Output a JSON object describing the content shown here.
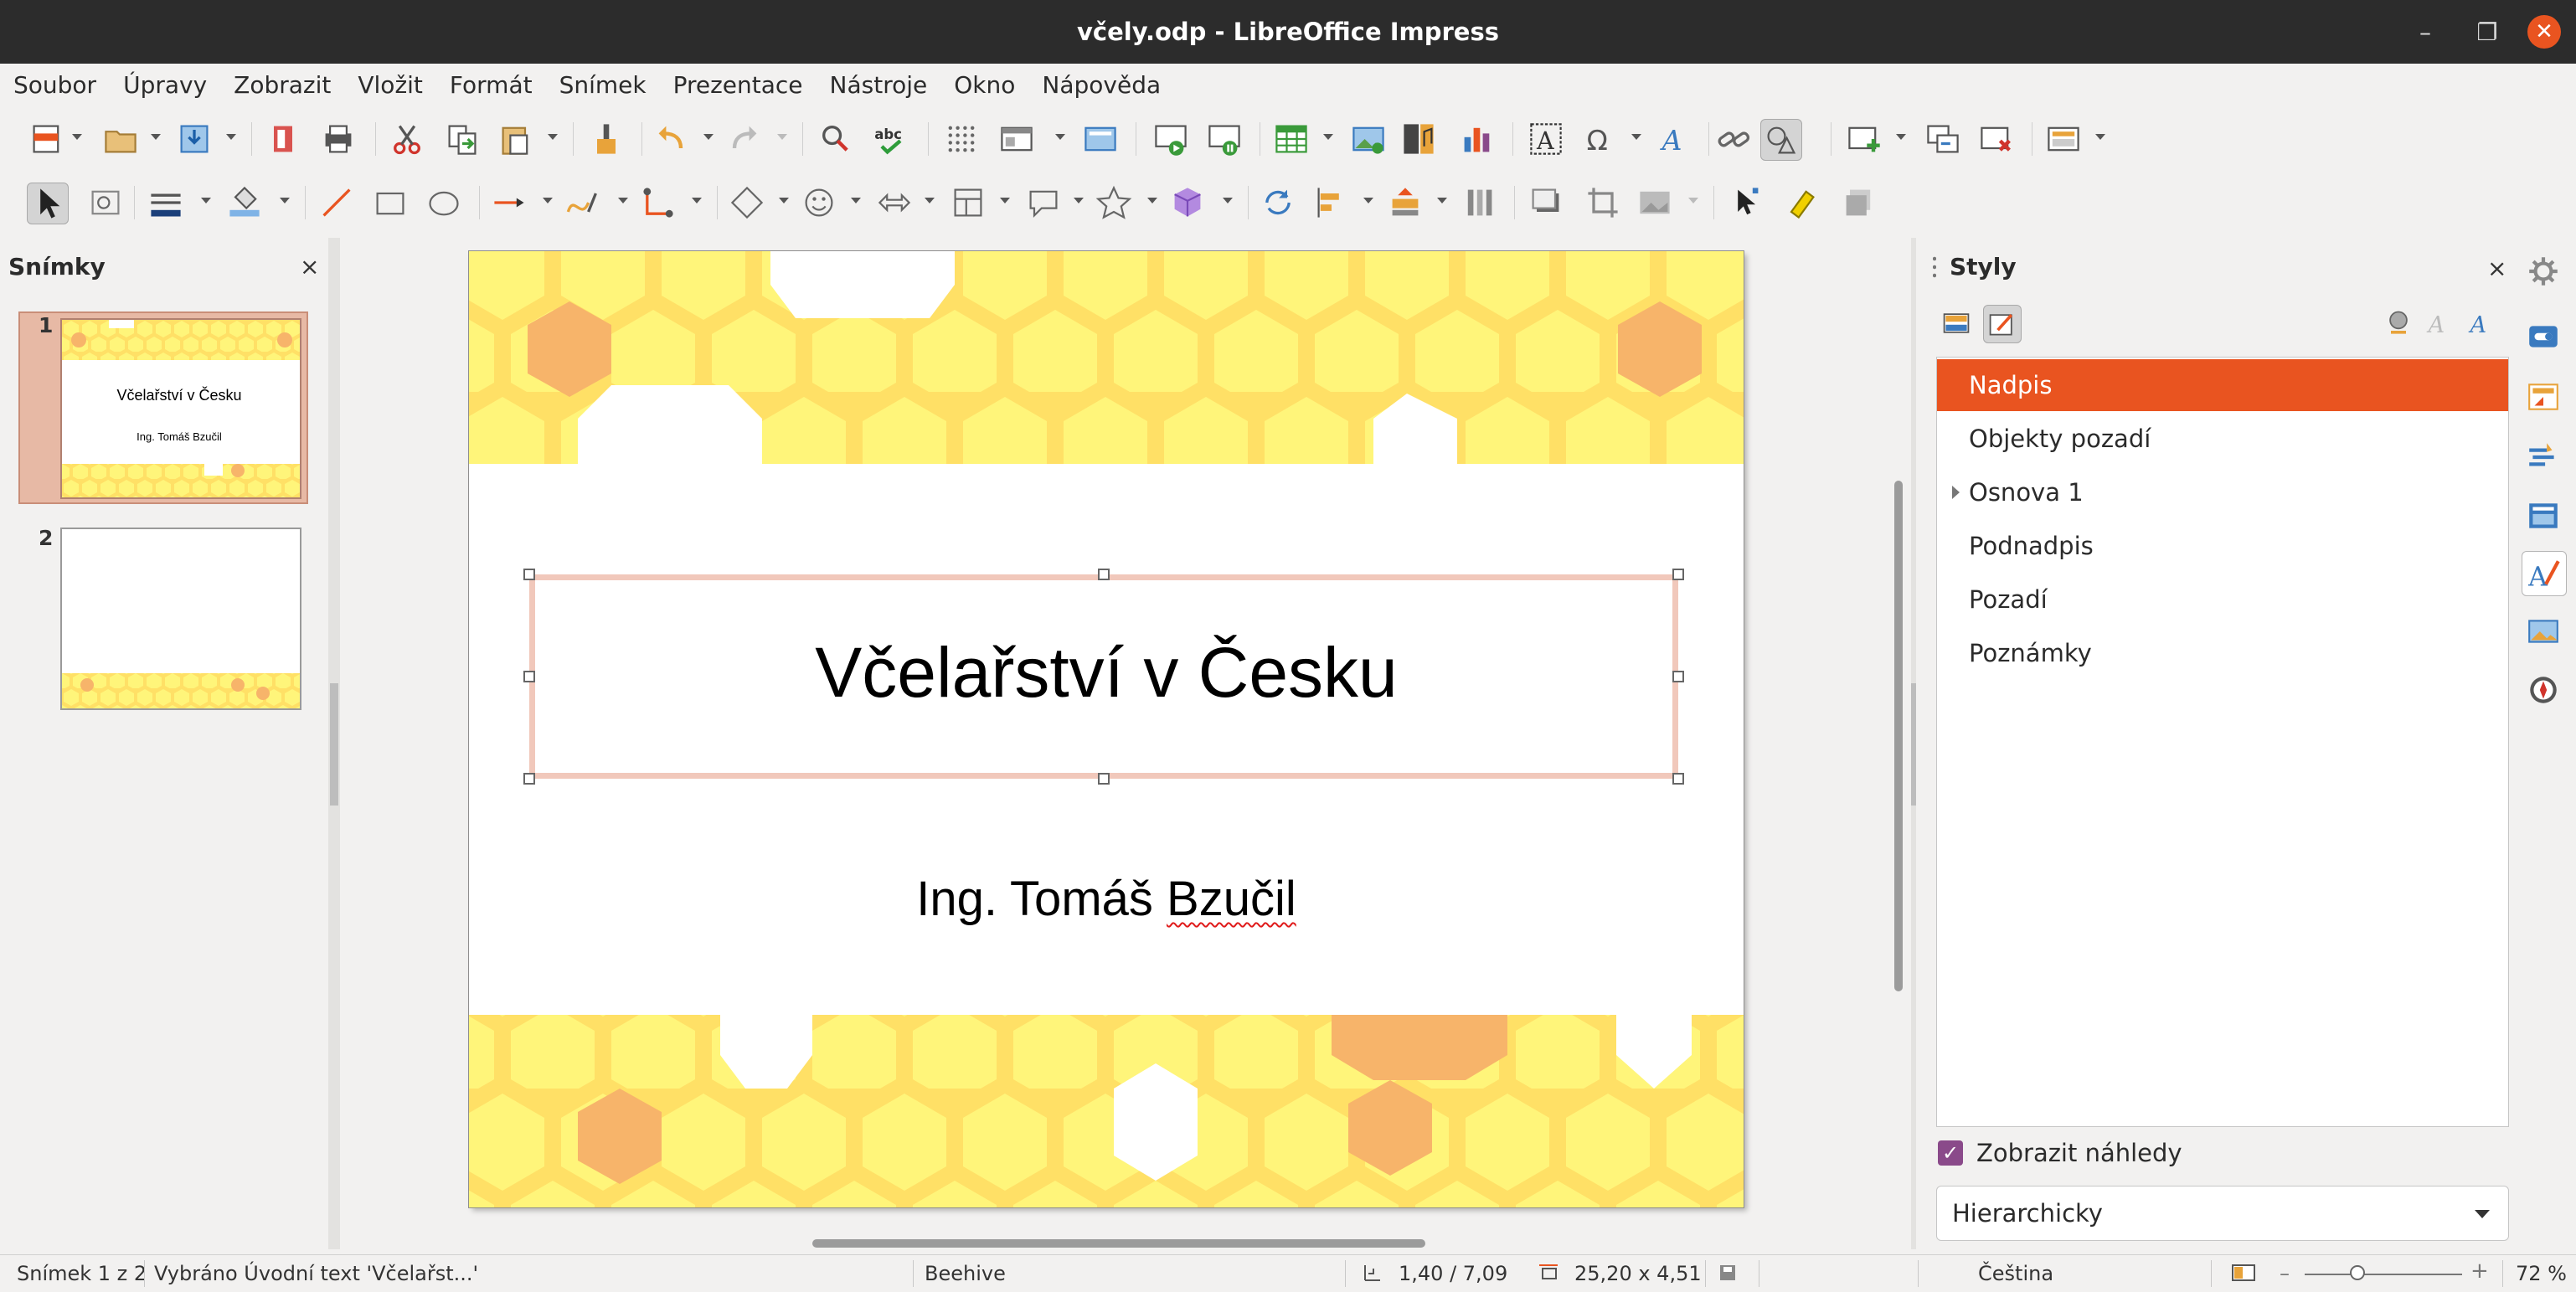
{
  "window": {
    "title": "včely.odp - LibreOffice Impress"
  },
  "menu": [
    "Soubor",
    "Úpravy",
    "Zobrazit",
    "Vložit",
    "Formát",
    "Snímek",
    "Prezentace",
    "Nástroje",
    "Okno",
    "Nápověda"
  ],
  "slides_panel": {
    "title": "Snímky",
    "slides": [
      {
        "number": "1",
        "title": "Včelařství v Česku",
        "subtitle": "Ing. Tomáš Bzučil"
      },
      {
        "number": "2"
      }
    ]
  },
  "slide": {
    "title": "Včelařství v Česku",
    "subtitle_start": "Ing. Tomáš ",
    "subtitle_misspelled": "Bzučil"
  },
  "styles": {
    "title": "Styly",
    "items": [
      "Nadpis",
      "Objekty pozadí",
      "Osnova 1",
      "Podnadpis",
      "Pozadí",
      "Poznámky"
    ],
    "selected": "Nadpis",
    "show_previews_label": "Zobrazit náhledy",
    "show_previews_checked": true,
    "filter": "Hierarchicky"
  },
  "status": {
    "slide": "Snímek 1 z 2",
    "selection": "Vybráno Úvodní text 'Včelařst...'",
    "master": "Beehive",
    "position": "1,40 / 7,09",
    "size": "25,20 x 4,51",
    "language": "Čeština",
    "zoom": "72 %"
  },
  "colors": {
    "accent": "#e95420",
    "honey_light": "#fff57a",
    "honey_dark": "#f7b46a"
  }
}
